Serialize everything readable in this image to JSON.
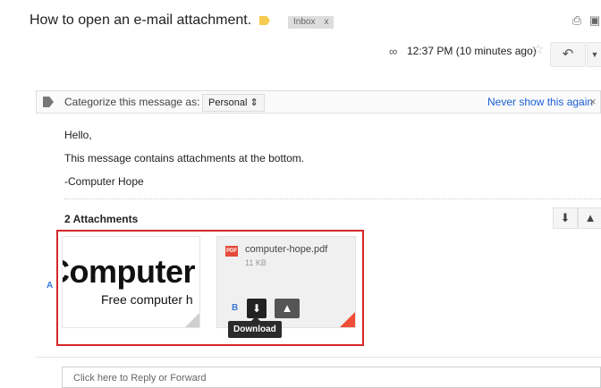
{
  "header": {
    "subject": "How to open an e-mail attachment.",
    "label": "Inbox",
    "label_close": "x",
    "label_color": "#f7cb4d"
  },
  "meta": {
    "datetime": "12:37 PM (10 minutes ago)",
    "attachment_icon": "paperclip-icon",
    "star_icon": "star-icon",
    "reply_icon": "reply-icon",
    "more_icon": "chevron-down-icon"
  },
  "categorize": {
    "text": "Categorize this message as:",
    "selected": "Personal",
    "never_show": "Never show this again",
    "close": "×"
  },
  "body": {
    "lines": [
      "Hello,",
      "This message contains attachments at the bottom.",
      "-Computer Hope"
    ]
  },
  "attachments": {
    "title": "2 Attachments",
    "marker_a": "A",
    "marker_b": "B",
    "preview": {
      "big": "Computer",
      "sub": "Free computer h"
    },
    "file": {
      "badge": "PDF",
      "name": "computer-hope.pdf",
      "size": "11 KB"
    },
    "tooltip": "Download",
    "accent_color": "#d62828",
    "link_color": "#1a5fd6"
  },
  "reply": {
    "placeholder": "Click here to Reply or Forward"
  }
}
